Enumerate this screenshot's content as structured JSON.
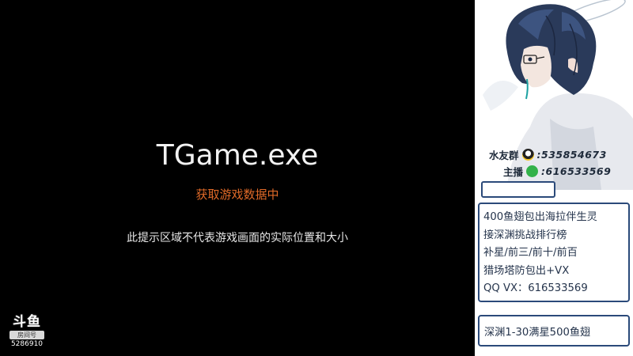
{
  "game": {
    "title": "TGame.exe",
    "status": "获取游戏数据中",
    "hint": "此提示区域不代表游戏画面的实际位置和大小"
  },
  "watermark": {
    "logo": "斗鱼",
    "tag": "房间号",
    "room_id": "5286910"
  },
  "sidebar": {
    "contacts": [
      {
        "label": "水友群",
        "icon": "qq-icon",
        "number": ":535854673"
      },
      {
        "label": "主播",
        "icon": "wechat-icon",
        "number": ":616533569"
      }
    ],
    "info_lines": [
      "400鱼翅包出海拉伴生灵",
      "接深渊挑战排行榜",
      "补星/前三/前十/前百",
      "猎场塔防包出+VX",
      "QQ VX：616533569"
    ],
    "bottom_text": "深渊1-30满星500鱼翅"
  },
  "colors": {
    "status_orange": "#e06a28",
    "panel_border": "#2b4a7a",
    "text_navy": "#25344c"
  }
}
